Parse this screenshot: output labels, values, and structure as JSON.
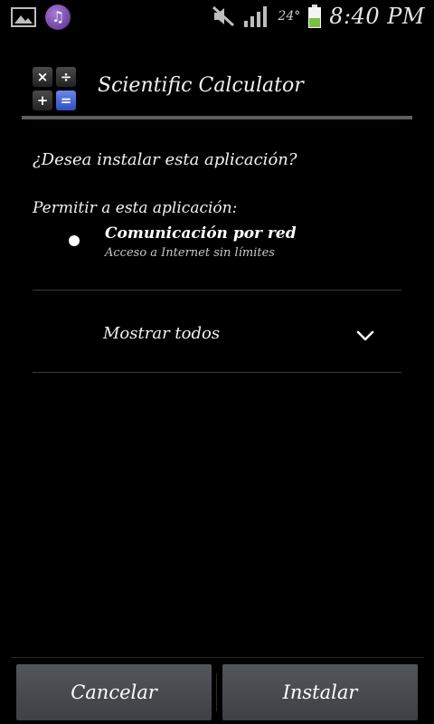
{
  "status_bar": {
    "temperature": "24°",
    "time": "8:40 PM",
    "icons": [
      "gallery-icon",
      "music-icon",
      "mute-icon",
      "signal-icon",
      "battery-icon"
    ],
    "battery_color": "#7bc043"
  },
  "header": {
    "app_title": "Scientific Calculator",
    "app_icon_keys": [
      "×",
      "÷",
      "+",
      "="
    ]
  },
  "body": {
    "question": "¿Desea instalar esta aplicación?",
    "permissions_label": "Permitir a esta aplicación:",
    "permissions": [
      {
        "title": "Comunicación por red",
        "description": "Acceso a Internet sin límites"
      }
    ],
    "show_all_label": "Mostrar todos"
  },
  "buttons": {
    "cancel_label": "Cancelar",
    "install_label": "Instalar"
  }
}
